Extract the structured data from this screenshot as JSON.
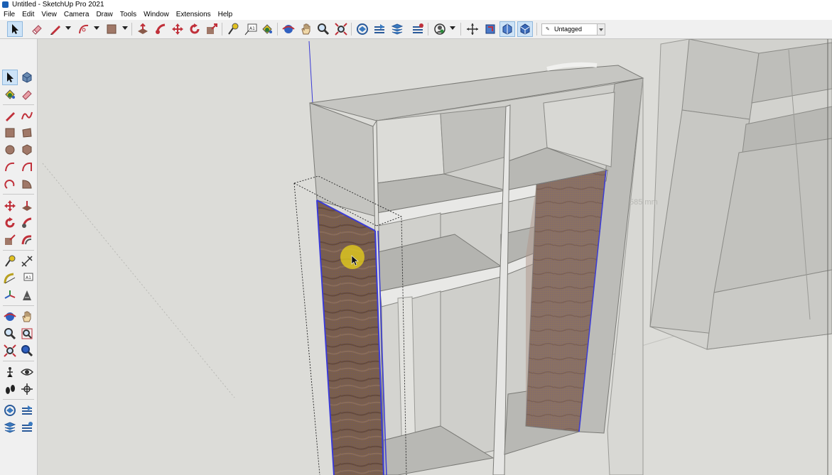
{
  "window": {
    "title": "Untitled - SketchUp Pro 2021"
  },
  "menu": [
    "File",
    "Edit",
    "View",
    "Camera",
    "Draw",
    "Tools",
    "Window",
    "Extensions",
    "Help"
  ],
  "toolbar": {
    "tag_select": {
      "value": "Untagged"
    },
    "icons": [
      "select-icon",
      "eraser-icon",
      "line-pencil-icon",
      "arc-icon",
      "rectangle-icon",
      "push-pull-icon",
      "follow-me-icon",
      "move-icon",
      "rotate-icon",
      "scale-icon",
      "tape-measure-icon",
      "text-icon",
      "paint-bucket-icon",
      "orbit-icon",
      "pan-icon",
      "zoom-icon",
      "zoom-extents-icon",
      "warehouse-icon",
      "warehouse-share-icon",
      "extension-warehouse-icon",
      "layout-icon",
      "user-account-icon",
      "position-camera-icon",
      "section-plane-icon",
      "display-section-planes-icon",
      "display-section-cuts-icon"
    ]
  },
  "left_toolbar": {
    "icons": [
      "select-icon",
      "make-component-icon",
      "paint-bucket-icon",
      "eraser-icon",
      "line-icon",
      "freehand-icon",
      "rectangle-icon",
      "rotated-rectangle-icon",
      "circle-icon",
      "polygon-icon",
      "arc-icon",
      "two-point-arc-icon",
      "three-point-arc-icon",
      "pie-icon",
      "move-icon",
      "push-pull-icon",
      "rotate-icon",
      "follow-me-icon",
      "scale-icon",
      "offset-icon",
      "tape-measure-icon",
      "dimension-icon",
      "protractor-icon",
      "text-icon",
      "axes-icon",
      "3d-text-icon",
      "orbit-icon",
      "pan-icon",
      "zoom-icon",
      "zoom-window-icon",
      "zoom-extents-icon",
      "search-warehouse-icon",
      "position-camera-icon",
      "look-around-icon",
      "walk-icon",
      "section-plane-icon",
      "warehouse-icon",
      "extension-warehouse-icon",
      "layout-icon",
      "share-model-icon"
    ]
  },
  "viewport": {
    "dimension_label": "585 mm",
    "colors": {
      "background": "#dcdcd8",
      "wood": "#7b5f49",
      "selection": "#3b3bd6",
      "cursor_highlight": "#e8d21a"
    }
  }
}
